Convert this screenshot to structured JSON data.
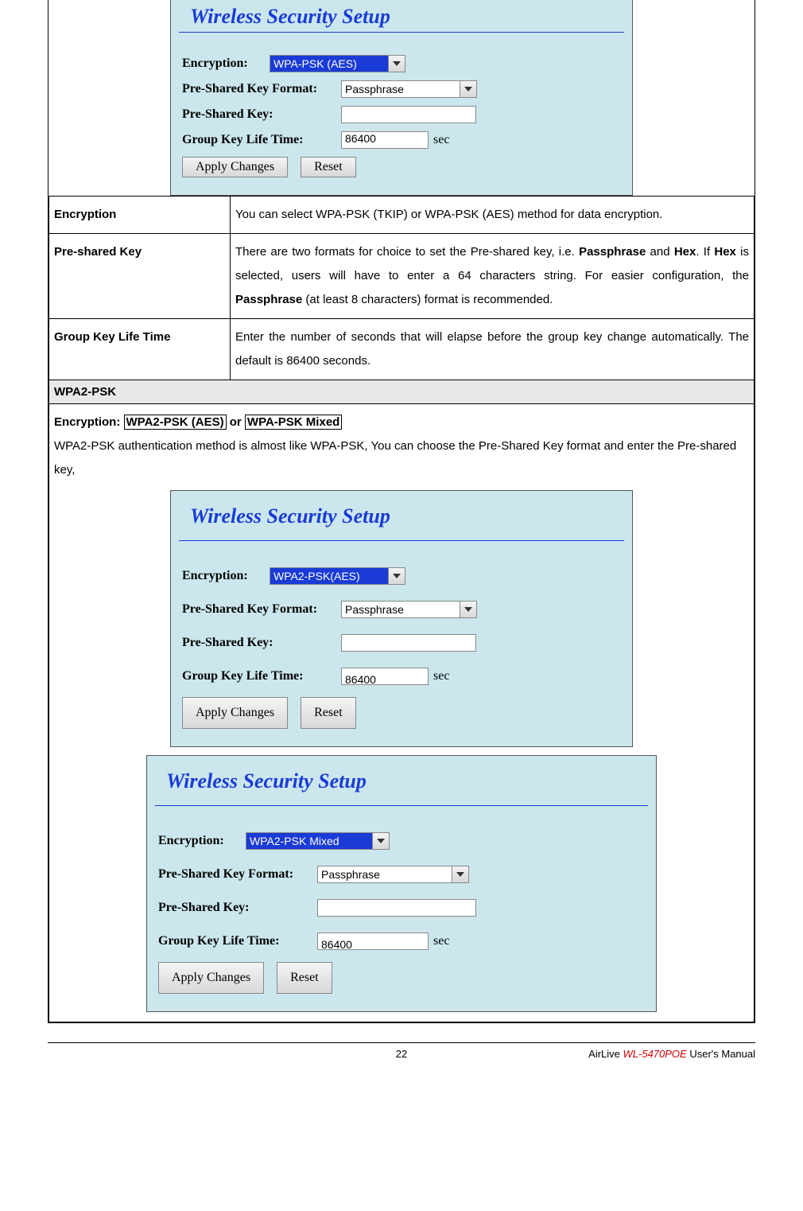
{
  "panel1": {
    "title": "Wireless Security Setup",
    "labels": {
      "encryption": "Encryption:",
      "psk_format": "Pre-Shared Key Format:",
      "psk": "Pre-Shared Key:",
      "gklt": "Group Key Life Time:"
    },
    "values": {
      "encryption": "WPA-PSK (AES)",
      "psk_format": "Passphrase",
      "psk": "",
      "gklt": "86400",
      "sec": "sec"
    },
    "buttons": {
      "apply": "Apply Changes",
      "reset": "Reset"
    }
  },
  "table": {
    "rows": [
      {
        "key": "Encryption",
        "desc": "You can select WPA-PSK (TKIP) or WPA-PSK (AES) method for data encryption."
      },
      {
        "key": "Pre-shared Key",
        "desc_html": "There are two formats for choice to set the Pre-shared key, i.e. <b>Passphrase</b> and <b>Hex</b>. If <b>Hex</b> is selected, users will have to enter a 64 characters string. For easier configuration, the <b>Passphrase</b> (at least 8 characters) format is recommended."
      },
      {
        "key": "Group Key Life Time",
        "desc": "Enter the number of seconds that will elapse before the group key change automatically. The default is 86400 seconds."
      }
    ]
  },
  "wpa2": {
    "header": "WPA2-PSK",
    "line_prefix": "Encryption:",
    "opt1": "WPA2-PSK (AES)",
    "or": "or",
    "opt2": "WPA-PSK Mixed",
    "body": "WPA2-PSK authentication method is almost like WPA-PSK, You can choose the Pre-Shared Key format and enter the Pre-shared key,"
  },
  "panel2": {
    "title": "Wireless Security Setup",
    "labels": {
      "encryption": "Encryption:",
      "psk_format": "Pre-Shared Key Format:",
      "psk": "Pre-Shared Key:",
      "gklt": "Group Key Life Time:"
    },
    "values": {
      "encryption": "WPA2-PSK(AES)",
      "psk_format": "Passphrase",
      "psk": "",
      "gklt": "86400",
      "sec": "sec"
    },
    "buttons": {
      "apply": "Apply Changes",
      "reset": "Reset"
    }
  },
  "panel3": {
    "title": "Wireless Security Setup",
    "labels": {
      "encryption": "Encryption:",
      "psk_format": "Pre-Shared Key Format:",
      "psk": "Pre-Shared Key:",
      "gklt": "Group Key Life Time:"
    },
    "values": {
      "encryption": "WPA2-PSK Mixed",
      "psk_format": "Passphrase",
      "psk": "",
      "gklt": "86400",
      "sec": "sec"
    },
    "buttons": {
      "apply": "Apply Changes",
      "reset": "Reset"
    }
  },
  "footer": {
    "page": "22",
    "brand": "AirLive ",
    "model": "WL-5470POE",
    "suffix": " User's Manual"
  }
}
